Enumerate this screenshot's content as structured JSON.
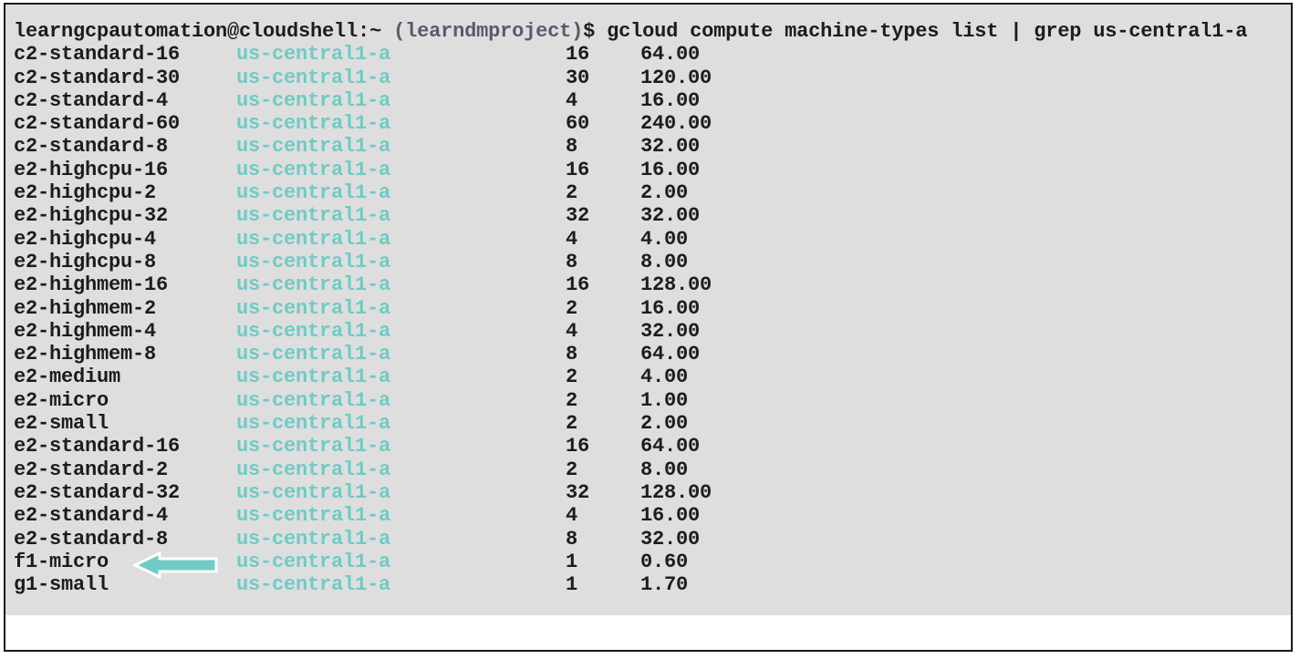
{
  "terminal": {
    "prompt": {
      "user_host": "learngcpautomation@cloudshell:~",
      "project": "(learndmproject)",
      "command": "$ gcloud compute machine-types list | grep us-central1-a"
    },
    "colors": {
      "background": "#dedede",
      "text": "#1c1c1c",
      "zone": "#6fcbc4",
      "arrow": "#6fcbc4"
    },
    "rows": [
      {
        "name": "c2-standard-16",
        "zone": "us-central1-a",
        "cpus": "16",
        "memory": "64.00"
      },
      {
        "name": "c2-standard-30",
        "zone": "us-central1-a",
        "cpus": "30",
        "memory": "120.00"
      },
      {
        "name": "c2-standard-4",
        "zone": "us-central1-a",
        "cpus": "4",
        "memory": "16.00"
      },
      {
        "name": "c2-standard-60",
        "zone": "us-central1-a",
        "cpus": "60",
        "memory": "240.00"
      },
      {
        "name": "c2-standard-8",
        "zone": "us-central1-a",
        "cpus": "8",
        "memory": "32.00"
      },
      {
        "name": "e2-highcpu-16",
        "zone": "us-central1-a",
        "cpus": "16",
        "memory": "16.00"
      },
      {
        "name": "e2-highcpu-2",
        "zone": "us-central1-a",
        "cpus": "2",
        "memory": "2.00"
      },
      {
        "name": "e2-highcpu-32",
        "zone": "us-central1-a",
        "cpus": "32",
        "memory": "32.00"
      },
      {
        "name": "e2-highcpu-4",
        "zone": "us-central1-a",
        "cpus": "4",
        "memory": "4.00"
      },
      {
        "name": "e2-highcpu-8",
        "zone": "us-central1-a",
        "cpus": "8",
        "memory": "8.00"
      },
      {
        "name": "e2-highmem-16",
        "zone": "us-central1-a",
        "cpus": "16",
        "memory": "128.00"
      },
      {
        "name": "e2-highmem-2",
        "zone": "us-central1-a",
        "cpus": "2",
        "memory": "16.00"
      },
      {
        "name": "e2-highmem-4",
        "zone": "us-central1-a",
        "cpus": "4",
        "memory": "32.00"
      },
      {
        "name": "e2-highmem-8",
        "zone": "us-central1-a",
        "cpus": "8",
        "memory": "64.00"
      },
      {
        "name": "e2-medium",
        "zone": "us-central1-a",
        "cpus": "2",
        "memory": "4.00"
      },
      {
        "name": "e2-micro",
        "zone": "us-central1-a",
        "cpus": "2",
        "memory": "1.00"
      },
      {
        "name": "e2-small",
        "zone": "us-central1-a",
        "cpus": "2",
        "memory": "2.00"
      },
      {
        "name": "e2-standard-16",
        "zone": "us-central1-a",
        "cpus": "16",
        "memory": "64.00"
      },
      {
        "name": "e2-standard-2",
        "zone": "us-central1-a",
        "cpus": "2",
        "memory": "8.00"
      },
      {
        "name": "e2-standard-32",
        "zone": "us-central1-a",
        "cpus": "32",
        "memory": "128.00"
      },
      {
        "name": "e2-standard-4",
        "zone": "us-central1-a",
        "cpus": "4",
        "memory": "16.00"
      },
      {
        "name": "e2-standard-8",
        "zone": "us-central1-a",
        "cpus": "8",
        "memory": "32.00"
      },
      {
        "name": "f1-micro",
        "zone": "us-central1-a",
        "cpus": "1",
        "memory": "0.60",
        "highlighted": true
      },
      {
        "name": "g1-small",
        "zone": "us-central1-a",
        "cpus": "1",
        "memory": "1.70"
      }
    ],
    "highlight_icon": "left-arrow-icon"
  }
}
